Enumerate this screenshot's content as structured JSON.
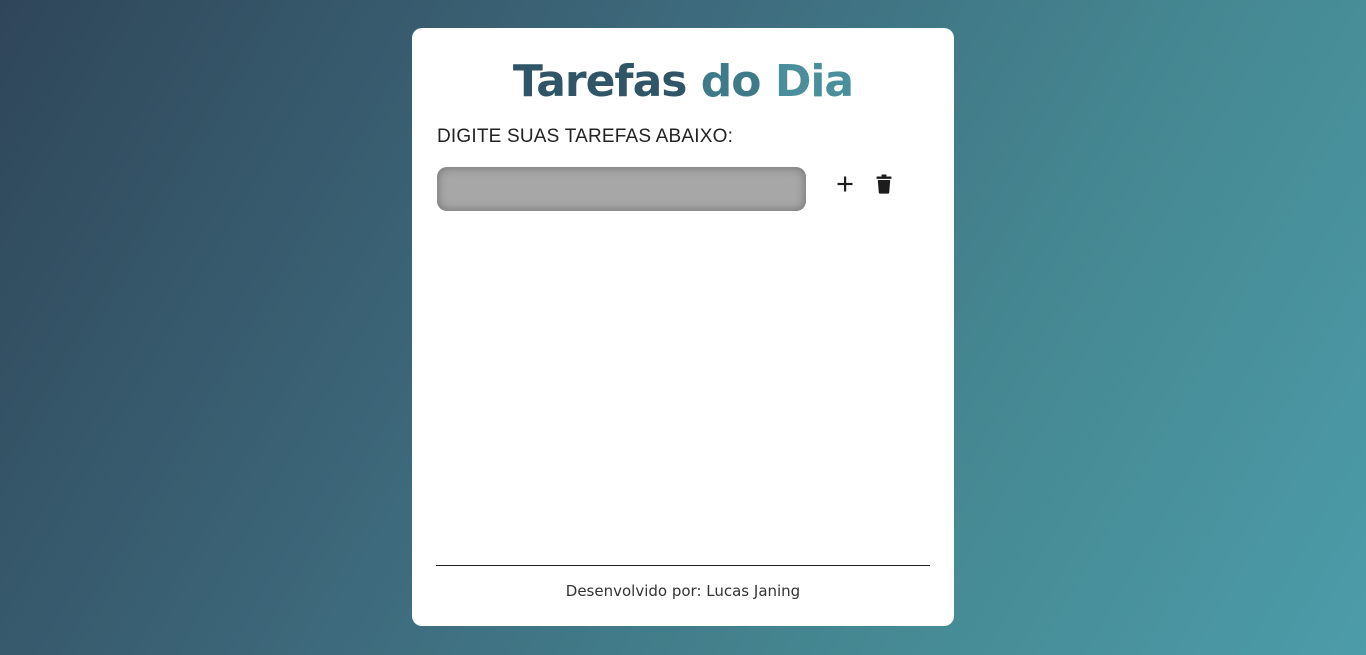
{
  "app": {
    "title_parts": [
      "Tarefas ",
      "do ",
      "Dia"
    ],
    "instructions": "DIGITE SUAS TAREFAS ABAIXO:",
    "footer": "Desenvolvido por: Lucas Janing"
  },
  "task_input": {
    "value": "",
    "placeholder": ""
  },
  "icons": {
    "add": "plus-icon",
    "delete": "trash-icon"
  },
  "colors": {
    "background_start": "#2f4659",
    "background_end": "#4c9ca9",
    "title_dark": "#2f5566",
    "title_light": "#4a8f9b",
    "input_bg": "#a7a7a8"
  }
}
